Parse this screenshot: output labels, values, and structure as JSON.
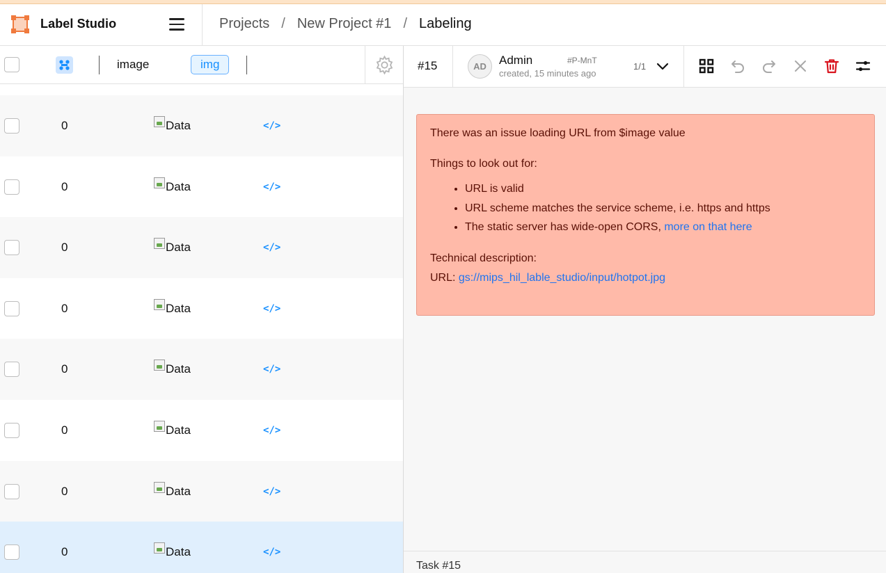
{
  "app": {
    "brand_name": "Label Studio",
    "accent_color": "#1890ff",
    "logo_color": "#f07a3e"
  },
  "breadcrumb": [
    {
      "label": "Projects"
    },
    {
      "label": "New Project #1"
    },
    {
      "label": "Labeling"
    }
  ],
  "breadcrumb_separator": "/",
  "table": {
    "columns": {
      "image": "image",
      "img_tag": "img"
    },
    "rows": [
      {
        "value": "0",
        "image_alt": "Data",
        "code": "</>",
        "state": "alt"
      },
      {
        "value": "0",
        "image_alt": "Data",
        "code": "</>",
        "state": "normal"
      },
      {
        "value": "0",
        "image_alt": "Data",
        "code": "</>",
        "state": "alt"
      },
      {
        "value": "0",
        "image_alt": "Data",
        "code": "</>",
        "state": "normal"
      },
      {
        "value": "0",
        "image_alt": "Data",
        "code": "</>",
        "state": "alt"
      },
      {
        "value": "0",
        "image_alt": "Data",
        "code": "</>",
        "state": "normal"
      },
      {
        "value": "0",
        "image_alt": "Data",
        "code": "</>",
        "state": "alt"
      },
      {
        "value": "0",
        "image_alt": "Data",
        "code": "</>",
        "state": "selected"
      }
    ]
  },
  "annotation": {
    "task_id": "#15",
    "avatar_initials": "AD",
    "user_name": "Admin",
    "annotation_id": "#P-MnT",
    "created": "created, 15 minutes ago",
    "count": "1/1"
  },
  "toolbar_icons": [
    "grid-icon",
    "undo-icon",
    "redo-icon",
    "close-icon",
    "delete-icon",
    "settings-sliders-icon"
  ],
  "error": {
    "title": "There was an issue loading URL from $image value",
    "lookout_heading": "Things to look out for:",
    "items": [
      "URL is valid",
      "URL scheme matches the service scheme, i.e. https and https",
      "The static server has wide-open CORS, "
    ],
    "cors_link": "more on that here",
    "tech_heading": "Technical description:",
    "url_label": "URL: ",
    "url_value": "gs://mips_hil_lable_studio/input/hotpot.jpg",
    "bg_color": "#ffbaa9",
    "text_color": "#5a1006"
  },
  "footer": {
    "task_label": "Task #15"
  }
}
